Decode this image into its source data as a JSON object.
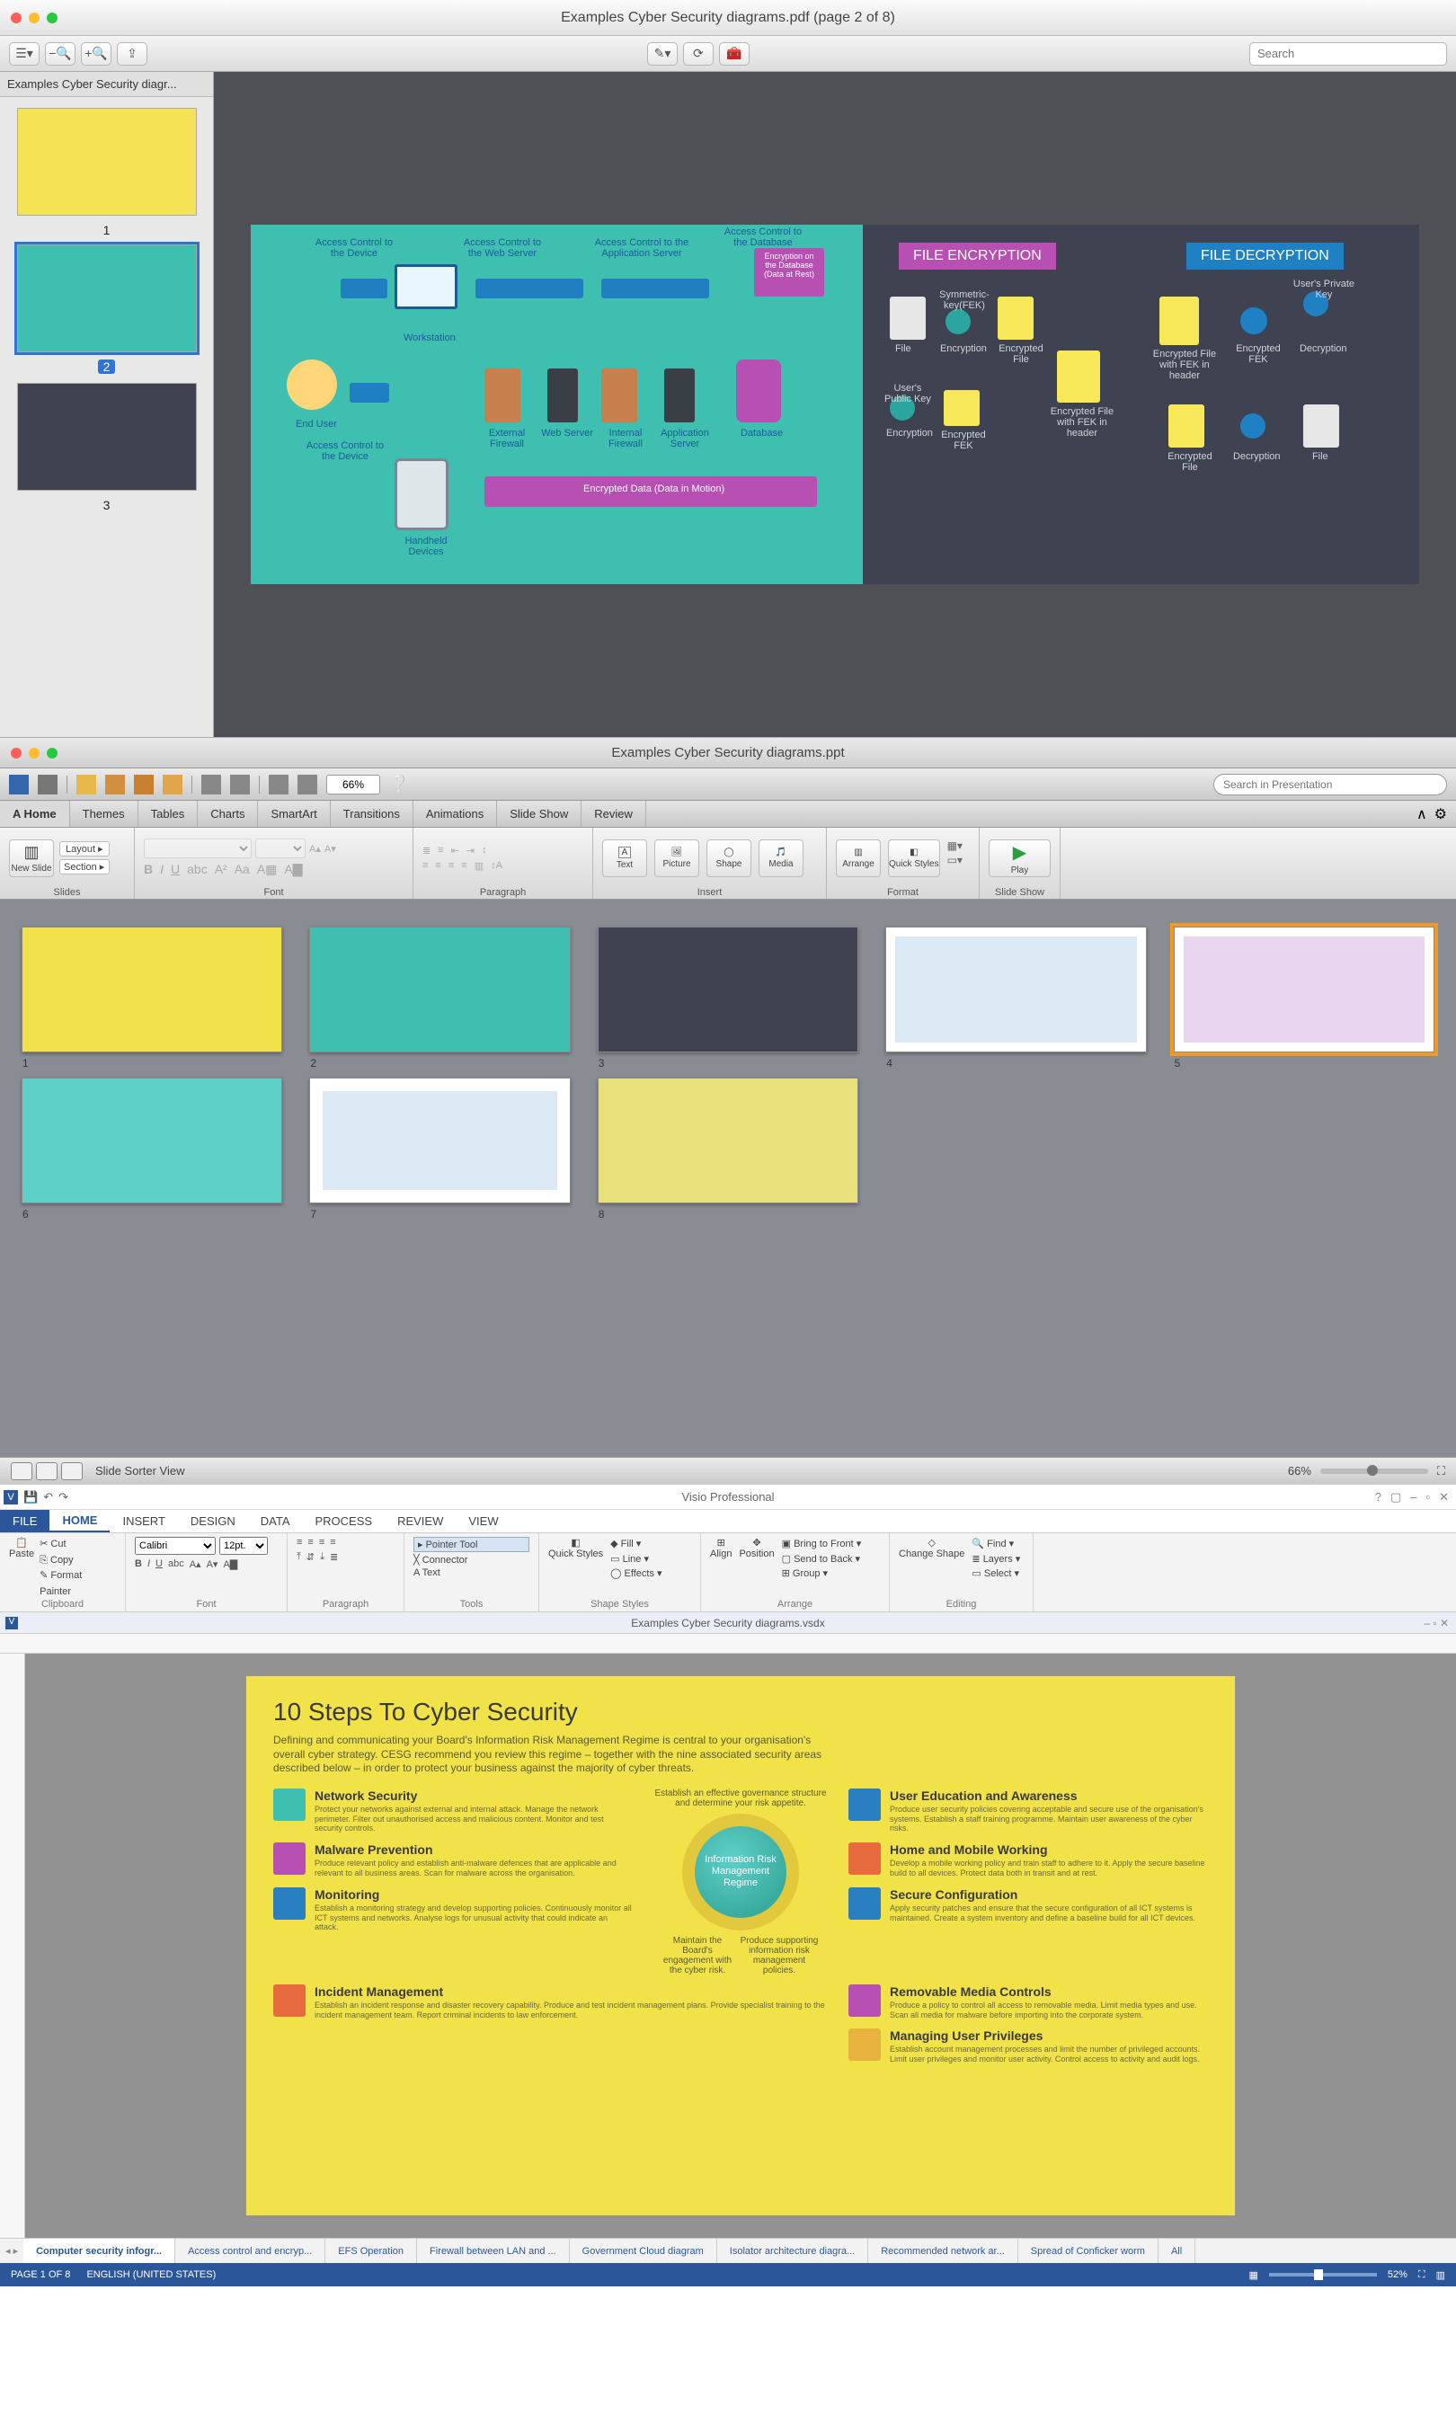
{
  "preview": {
    "title": "Examples Cyber Security diagrams.pdf (page 2 of 8)",
    "sidebar_title": "Examples Cyber Security diagr...",
    "search_placeholder": "Search",
    "thumbs": [
      "1",
      "2",
      "3"
    ],
    "selected_thumb": "2",
    "page2": {
      "ac_device": "Access Control to the Device",
      "ac_web": "Access Control to the Web Server",
      "ac_app": "Access Control to the Application Server",
      "ac_db": "Access Control to the Database",
      "db_box": "Encryption on the Database (Data at Rest)",
      "workstation": "Workstation",
      "enduser": "End User",
      "handheld": "Handheld Devices",
      "extfw": "External Firewall",
      "webserver": "Web Server",
      "intfw": "Internal Firewall",
      "appserver": "Application Server",
      "database": "Database",
      "encdata": "Encrypted Data (Data in Motion)",
      "file_enc": "FILE ENCRYPTION",
      "file_dec": "FILE DECRYPTION",
      "file": "File",
      "symkey": "Symmetric-key(FEK)",
      "encryption": "Encryption",
      "encfile": "Encrypted File",
      "userpub": "User's Public Key",
      "encfek": "Encrypted FEK",
      "encfile_hdr": "Encrypted File with FEK in header",
      "userpriv": "User's Private Key",
      "decryption": "Decryption"
    }
  },
  "ppt": {
    "title": "Examples Cyber Security diagrams.ppt",
    "zoom_field": "66%",
    "search_placeholder": "Search in Presentation",
    "tabs": [
      "A Home",
      "Themes",
      "Tables",
      "Charts",
      "SmartArt",
      "Transitions",
      "Animations",
      "Slide Show",
      "Review"
    ],
    "ribbon_groups": {
      "slides": "Slides",
      "font": "Font",
      "paragraph": "Paragraph",
      "insert": "Insert",
      "format": "Format",
      "slideshow": "Slide Show"
    },
    "ribbon_labels": {
      "new_slide": "New Slide",
      "layout": "Layout",
      "section": "Section",
      "text": "Text",
      "picture": "Picture",
      "shape": "Shape",
      "media": "Media",
      "arrange": "Arrange",
      "quick_styles": "Quick Styles",
      "play": "Play"
    },
    "slides": [
      "1",
      "2",
      "3",
      "4",
      "5",
      "6",
      "7",
      "8"
    ],
    "selected_slide": "5",
    "status_view": "Slide Sorter View",
    "status_zoom": "66%"
  },
  "visio": {
    "titlebar": "Visio Professional",
    "doc_title": "Examples Cyber Security diagrams.vsdx",
    "tabs": [
      "FILE",
      "HOME",
      "INSERT",
      "DESIGN",
      "DATA",
      "PROCESS",
      "REVIEW",
      "VIEW"
    ],
    "ribbon": {
      "clipboard": "Clipboard",
      "cut": "Cut",
      "copy": "Copy",
      "fp": "Format Painter",
      "paste": "Paste",
      "font": "Font",
      "font_name": "Calibri",
      "font_size": "12pt.",
      "paragraph": "Paragraph",
      "tools": "Tools",
      "pointer": "Pointer Tool",
      "connector": "Connector",
      "text_tool": "Text",
      "shape_styles": "Shape Styles",
      "fill": "Fill",
      "line": "Line",
      "effects": "Effects",
      "quick_styles": "Quick Styles",
      "arrange": "Arrange",
      "align": "Align",
      "position": "Position",
      "btf": "Bring to Front",
      "stb": "Send to Back",
      "group": "Group",
      "editing": "Editing",
      "change_shape": "Change Shape",
      "find": "Find",
      "layers": "Layers",
      "select": "Select"
    },
    "page": {
      "title": "10 Steps To Cyber Security",
      "intro": "Defining and communicating your Board's Information Risk Management Regime is central to your organisation's overall cyber strategy. CESG recommend you review this regime – together with the nine associated security areas described below – in order to protect your business against the majority of cyber threats.",
      "center_top": "Establish an effective governance structure and determine your risk appetite.",
      "center_mid": "Information Risk Management Regime",
      "center_left": "Maintain the Board's engagement with the cyber risk.",
      "center_right": "Produce supporting information risk management policies.",
      "items_left": [
        {
          "h": "Network Security",
          "p": "Protect your networks against external and internal attack. Manage the network perimeter. Filter out unauthorised access and malicious content. Monitor and test security controls."
        },
        {
          "h": "Malware Prevention",
          "p": "Produce relevant policy and establish anti-malware defences that are applicable and relevant to all business areas. Scan for malware across the organisation."
        },
        {
          "h": "Monitoring",
          "p": "Establish a monitoring strategy and develop supporting policies. Continuously monitor all ICT systems and networks. Analyse logs for unusual activity that could indicate an attack."
        },
        {
          "h": "Incident Management",
          "p": "Establish an incident response and disaster recovery capability. Produce and test incident management plans. Provide specialist training to the incident management team. Report criminal incidents to law enforcement."
        }
      ],
      "items_right": [
        {
          "h": "User Education and Awareness",
          "p": "Produce user security policies covering acceptable and secure use of the organisation's systems. Establish a staff training programme. Maintain user awareness of the cyber risks."
        },
        {
          "h": "Home and Mobile Working",
          "p": "Develop a mobile working policy and train staff to adhere to it. Apply the secure baseline build to all devices. Protect data both in transit and at rest."
        },
        {
          "h": "Secure Configuration",
          "p": "Apply security patches and ensure that the secure configuration of all ICT systems is maintained. Create a system inventory and define a baseline build for all ICT devices."
        },
        {
          "h": "Removable Media Controls",
          "p": "Produce a policy to control all access to removable media. Limit media types and use. Scan all media for malware before importing into the corporate system."
        },
        {
          "h": "Managing User Privileges",
          "p": "Establish account management processes and limit the number of privileged accounts. Limit user privileges and monitor user activity. Control access to activity and audit logs."
        }
      ]
    },
    "sheets": [
      "Computer security infogr...",
      "Access control and encryp...",
      "EFS Operation",
      "Firewall between LAN and ...",
      "Government Cloud diagram",
      "Isolator architecture diagra...",
      "Recommended network ar...",
      "Spread of Conficker worm",
      "All"
    ],
    "status_page": "PAGE 1 OF 8",
    "status_lang": "ENGLISH (UNITED STATES)",
    "status_zoom": "52%"
  }
}
